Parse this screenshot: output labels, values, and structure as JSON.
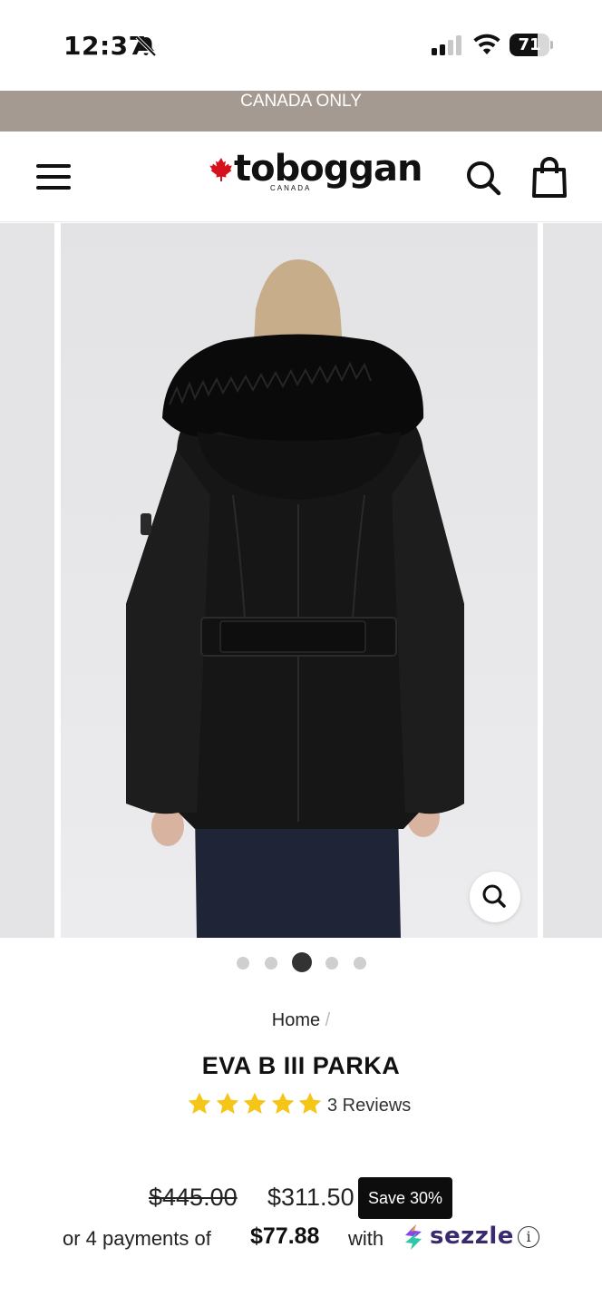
{
  "status_bar": {
    "time": "12:37",
    "battery": "71",
    "battery_level": 0.71,
    "icons": [
      "bell-slash-icon",
      "cellular-signal-icon",
      "wifi-icon",
      "battery-icon"
    ]
  },
  "announcement": {
    "text": "CANADA ONLY"
  },
  "header": {
    "logo_text": "toboggan",
    "logo_subtext": "CANADA",
    "icons": [
      "hamburger-menu-icon",
      "maple-leaf-icon",
      "search-icon",
      "shopping-bag-icon"
    ]
  },
  "gallery": {
    "image_description_icon": "zoom-icon",
    "slide_count": 5,
    "active_slide": 3
  },
  "product": {
    "breadcrumb_home": "Home",
    "breadcrumb_sep": "/",
    "title": "EVA B III PARKA",
    "rating": 5,
    "reviews": "3 Reviews",
    "price_original": "$445.00",
    "price_sale": "$311.50",
    "save_badge": "Save 30%",
    "sezzle_prefix": "or 4 payments of",
    "sezzle_amount": "$77.88",
    "sezzle_with": "with",
    "sezzle_brand": "sezzle",
    "info_glyph": "i"
  },
  "colors": {
    "announcement_bg": "#a59a91",
    "star": "#f5c518",
    "sezzle_brand": "#3b2a6e",
    "badge_bg": "#0d0d0d"
  }
}
